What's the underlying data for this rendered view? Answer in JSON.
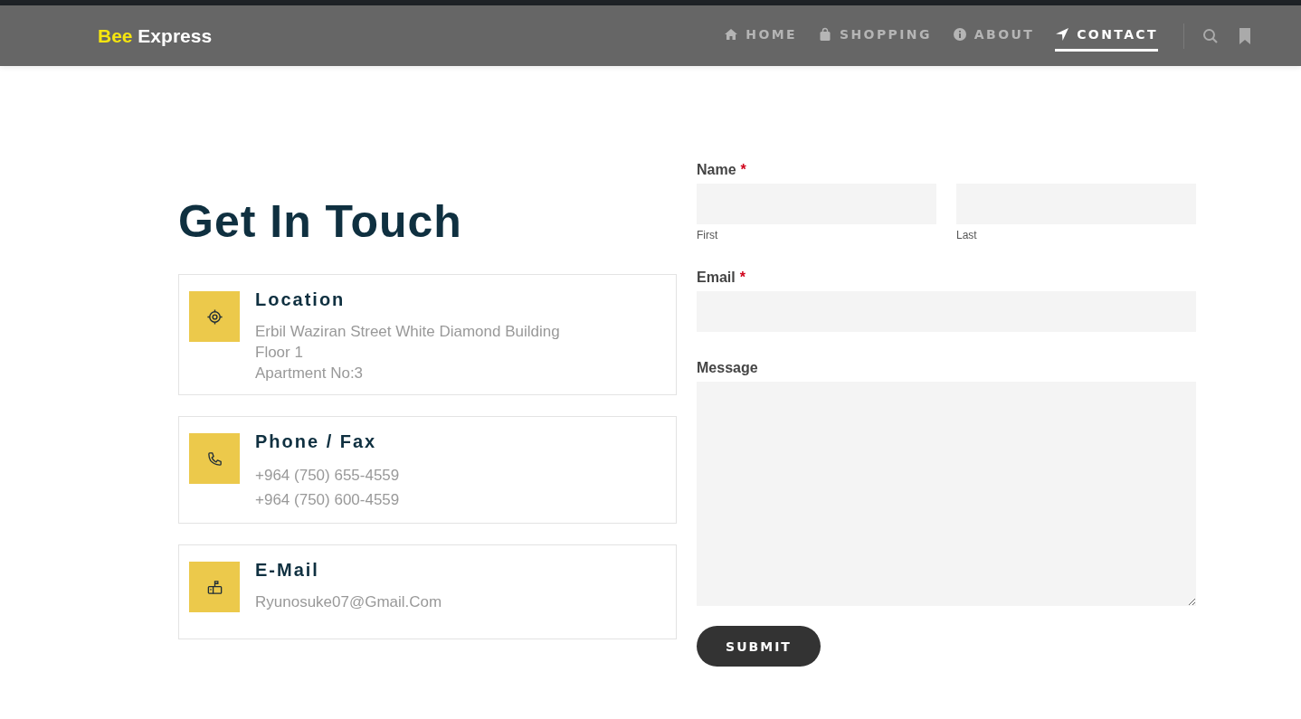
{
  "logo": {
    "highlight": "Bee",
    "text": "Express"
  },
  "nav": [
    {
      "label": "HOME",
      "kind": "home",
      "selected": false
    },
    {
      "label": "SHOPPING",
      "kind": "bag",
      "selected": false
    },
    {
      "label": "ABOUT",
      "kind": "info",
      "selected": false
    },
    {
      "label": "CONTACT",
      "kind": "send",
      "selected": true
    }
  ],
  "heading": "Get In Touch",
  "cards": [
    {
      "kind": "location",
      "title": "Location",
      "lines": [
        "Erbil Waziran Street White Diamond Building",
        "Floor 1",
        "Apartment No:3"
      ]
    },
    {
      "kind": "phone",
      "title": "Phone / Fax",
      "lines": [
        "+964 (750) 655-4559",
        "+964 (750) 600-4559"
      ]
    },
    {
      "kind": "mail",
      "title": "E-Mail",
      "lines": [
        "Ryunosuke07@Gmail.Com"
      ]
    }
  ],
  "form": {
    "fields": [
      {
        "kind": "name",
        "label": "Name",
        "required": true,
        "sublabels": [
          "First",
          "Last"
        ]
      },
      {
        "kind": "text",
        "label": "Email",
        "required": true
      },
      {
        "kind": "textarea",
        "label": "Message",
        "required": false
      }
    ],
    "required_mark": "*",
    "submit": "SUBMIT"
  }
}
